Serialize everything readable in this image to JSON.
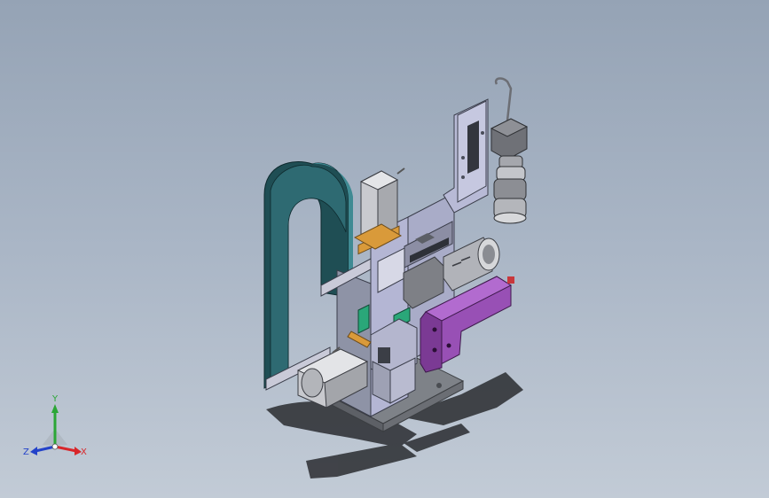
{
  "scene": {
    "background_top": "#95a3b5",
    "background_bottom": "#c2cbd6",
    "part_colors": {
      "guard": "#26585e",
      "frame": "#b7b9d6",
      "base": "#8d9197",
      "bracket_purple": "#9b4fb8",
      "accent_orange": "#d99a3a",
      "accent_green": "#2aa779",
      "motor": "#c8c9cd",
      "camera": "#7b7d82"
    }
  },
  "triad": {
    "x_label": "X",
    "y_label": "Y",
    "z_label": "Z",
    "x_color": "#d8262a",
    "y_color": "#2ba636",
    "z_color": "#2342c9"
  }
}
